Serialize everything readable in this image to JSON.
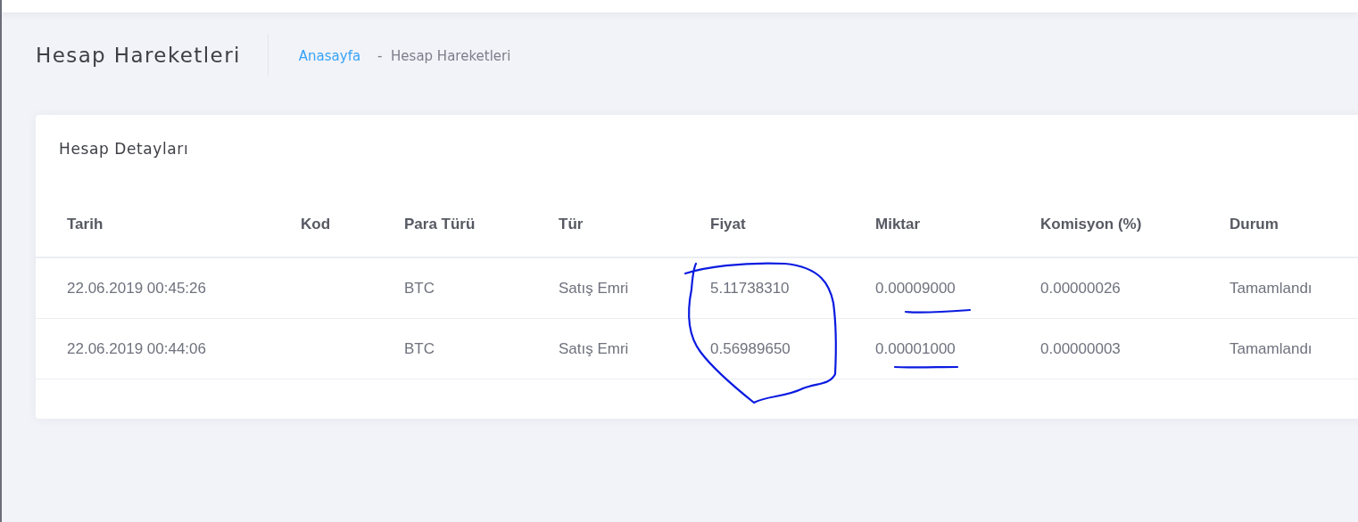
{
  "header": {
    "title": "Hesap Hareketleri",
    "breadcrumb": [
      {
        "label": "Anasayfa",
        "kind": "link"
      },
      {
        "label": "-  Hesap Hareketleri",
        "kind": "current"
      }
    ]
  },
  "card": {
    "title": "Hesap Detayları",
    "table": {
      "columns": [
        "Tarih",
        "Kod",
        "Para Türü",
        "Tür",
        "Fiyat",
        "Miktar",
        "Komisyon (%)",
        "Durum"
      ],
      "rows": [
        [
          "22.06.2019 00:45:26",
          "",
          "BTC",
          "Satış Emri",
          "5.11738310",
          "0.00009000",
          "0.00000026",
          "Tamamlandı"
        ],
        [
          "22.06.2019 00:44:06",
          "",
          "BTC",
          "Satış Emri",
          "0.56989650",
          "0.00001000",
          "0.00000003",
          "Tamamlandı"
        ]
      ]
    }
  },
  "pen_marks": [
    {
      "kind": "circle"
    },
    {
      "kind": "underline"
    },
    {
      "kind": "underline"
    }
  ]
}
